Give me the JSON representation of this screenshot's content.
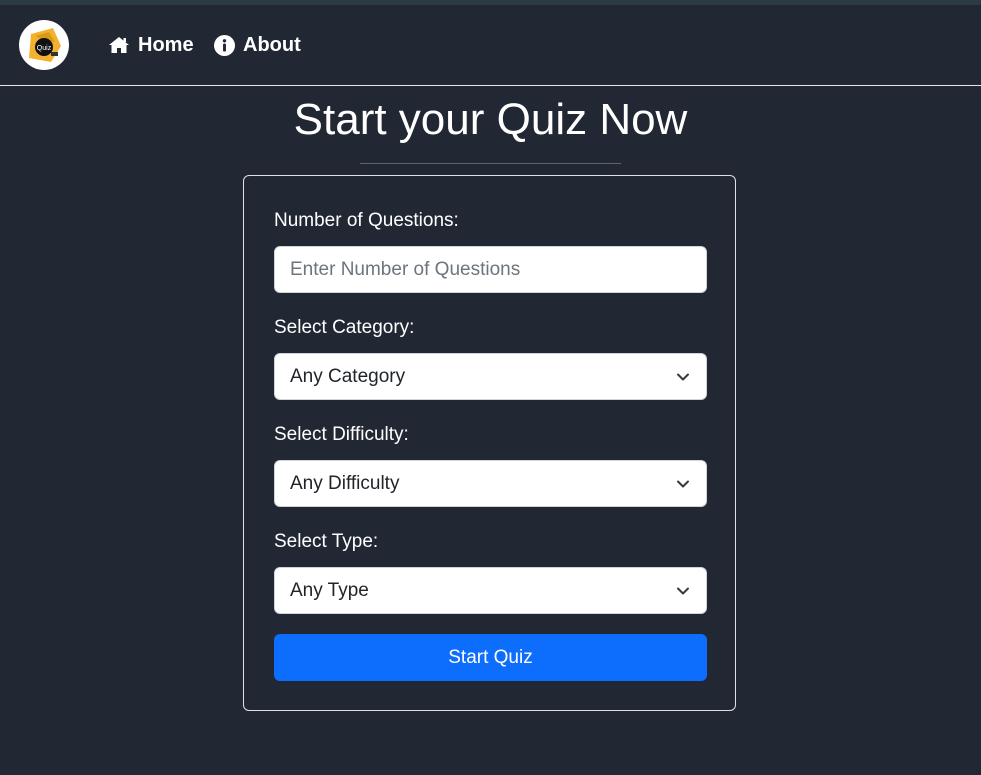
{
  "nav": {
    "logo_text": "Quiz",
    "links": [
      {
        "label": "Home",
        "icon": "home-icon"
      },
      {
        "label": "About",
        "icon": "info-icon"
      }
    ]
  },
  "page": {
    "title": "Start your Quiz Now"
  },
  "form": {
    "questions": {
      "label": "Number of Questions:",
      "placeholder": "Enter Number of Questions",
      "value": ""
    },
    "category": {
      "label": "Select Category:",
      "selected": "Any Category"
    },
    "difficulty": {
      "label": "Select Difficulty:",
      "selected": "Any Difficulty"
    },
    "type": {
      "label": "Select Type:",
      "selected": "Any Type"
    },
    "submit_label": "Start Quiz"
  },
  "colors": {
    "background": "#212834",
    "accent": "#0d6efd",
    "logo_gold": "#f2b22e"
  }
}
